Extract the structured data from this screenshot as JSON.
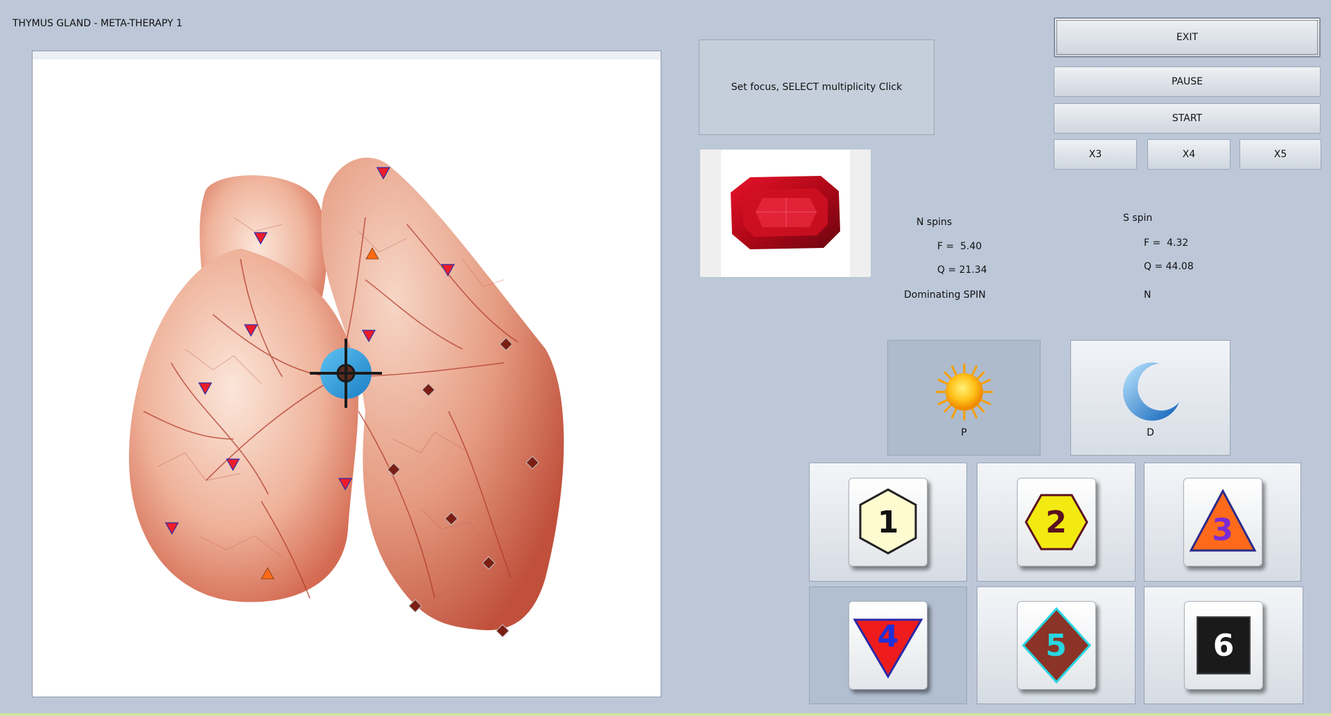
{
  "window": {
    "title": "THYMUS GLAND - META-THERAPY 1"
  },
  "controls": {
    "exit": "EXIT",
    "pause": "PAUSE",
    "start": "START",
    "multipliers": [
      "X3",
      "X4",
      "X5"
    ]
  },
  "hint": "Set focus, SELECT multiplicity Click",
  "readouts": {
    "n_spins": {
      "label": "N spins",
      "f": "F =  5.40",
      "q": "Q = 21.34"
    },
    "s_spin": {
      "label": "S spin",
      "f": "F =  4.32",
      "q": "Q = 44.08"
    },
    "dominating_label": "Dominating SPIN",
    "dominating_value": "N"
  },
  "modes": [
    {
      "label": "P",
      "icon": "sun-icon",
      "active": true
    },
    {
      "label": "D",
      "icon": "moon-icon",
      "active": false
    }
  ],
  "levels": [
    {
      "num": "1",
      "shape": "hexagon",
      "fill": "#fffbd0",
      "text_color": "#111111",
      "active": false
    },
    {
      "num": "2",
      "shape": "hexagon",
      "fill": "#f2ea10",
      "text_color": "#5a1020",
      "active": false
    },
    {
      "num": "3",
      "shape": "triangle-up",
      "fill": "#ff6a1a",
      "text_color": "#7a2bd6",
      "active": false
    },
    {
      "num": "4",
      "shape": "triangle-down",
      "fill": "#ee1c1c",
      "text_color": "#2030d8",
      "active": true
    },
    {
      "num": "5",
      "shape": "diamond",
      "fill": "#8a3326",
      "text_color": "#28d6e0",
      "active": false
    },
    {
      "num": "6",
      "shape": "square",
      "fill": "#1a1a1a",
      "text_color": "#ffffff",
      "active": false
    }
  ],
  "colors": {
    "background": "#bcc8d8",
    "marker_red": "#ee1c2a",
    "marker_orange": "#ff6a14",
    "marker_brown": "#7a1e14",
    "crosshair": "#2a9ad8"
  }
}
